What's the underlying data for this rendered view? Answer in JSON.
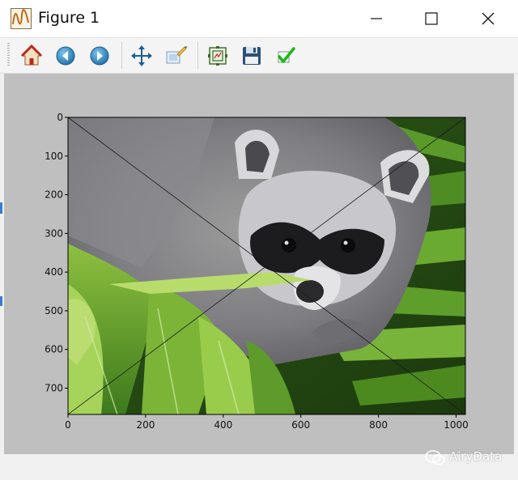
{
  "window": {
    "title": "Figure 1",
    "controls": [
      "minimize",
      "maximize",
      "close"
    ]
  },
  "toolbar": {
    "buttons": [
      {
        "name": "home",
        "icon": "home-icon"
      },
      {
        "name": "back",
        "icon": "arrow-left-icon"
      },
      {
        "name": "forward",
        "icon": "arrow-right-icon"
      },
      {
        "name": "pan",
        "icon": "move-arrows-icon"
      },
      {
        "name": "zoom",
        "icon": "zoom-rect-icon"
      },
      {
        "name": "configure-subplots",
        "icon": "subplots-icon"
      },
      {
        "name": "save",
        "icon": "floppy-disk-icon"
      },
      {
        "name": "edit",
        "icon": "checkmark-icon"
      }
    ]
  },
  "colors": {
    "figure_bg": "#bfbfbf",
    "toolbar_bg": "#f4f4f4",
    "titlebar_bg": "#ffffff"
  },
  "image_content": "raccoon-face-photo",
  "chart_data": {
    "type": "image",
    "x_ticks": [
      0,
      200,
      400,
      600,
      800,
      1000
    ],
    "y_ticks": [
      0,
      100,
      200,
      300,
      400,
      500,
      600,
      700
    ],
    "x_range": [
      0,
      1024
    ],
    "y_range": [
      768,
      0
    ],
    "lines": [
      {
        "x": [
          0,
          1024
        ],
        "y": [
          0,
          768
        ]
      },
      {
        "x": [
          0,
          1024
        ],
        "y": [
          768,
          0
        ]
      }
    ]
  },
  "watermark": {
    "icon": "wechat-icon",
    "text": "AiryData"
  }
}
